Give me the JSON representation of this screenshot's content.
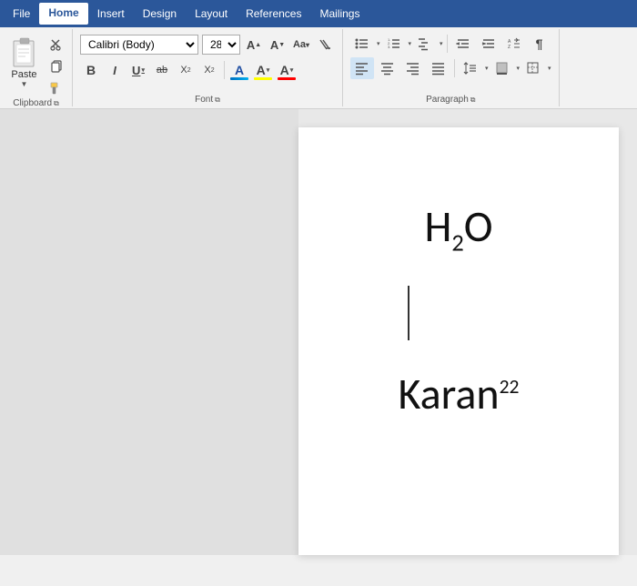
{
  "menu": {
    "items": [
      {
        "label": "File",
        "active": false
      },
      {
        "label": "Home",
        "active": true
      },
      {
        "label": "Insert",
        "active": false
      },
      {
        "label": "Design",
        "active": false
      },
      {
        "label": "Layout",
        "active": false
      },
      {
        "label": "References",
        "active": false
      },
      {
        "label": "Mailings",
        "active": false
      }
    ]
  },
  "ribbon": {
    "font_name": "Calibri (Body)",
    "font_size": "28",
    "groups": {
      "clipboard": "Clipboard",
      "font": "Font",
      "paragraph": "Paragraph"
    },
    "buttons": {
      "paste": "Paste",
      "bold": "B",
      "italic": "I",
      "underline": "U",
      "strikethrough": "ab",
      "subscript": "X₂",
      "superscript": "X²",
      "font_color_label": "A",
      "highlight_label": "A",
      "text_effect_label": "A",
      "grow_font": "A↑",
      "shrink_font": "A↓",
      "change_case": "Aa",
      "clear_format": "✕"
    },
    "colors": {
      "font_color": "#ff0000",
      "highlight_color": "#ffff00",
      "text_effect_color": "#0000ff"
    }
  },
  "document": {
    "h2o": "H",
    "h2o_sub": "2",
    "h2o_suffix": "O",
    "karan": "Karan",
    "karan_sup": "22"
  }
}
